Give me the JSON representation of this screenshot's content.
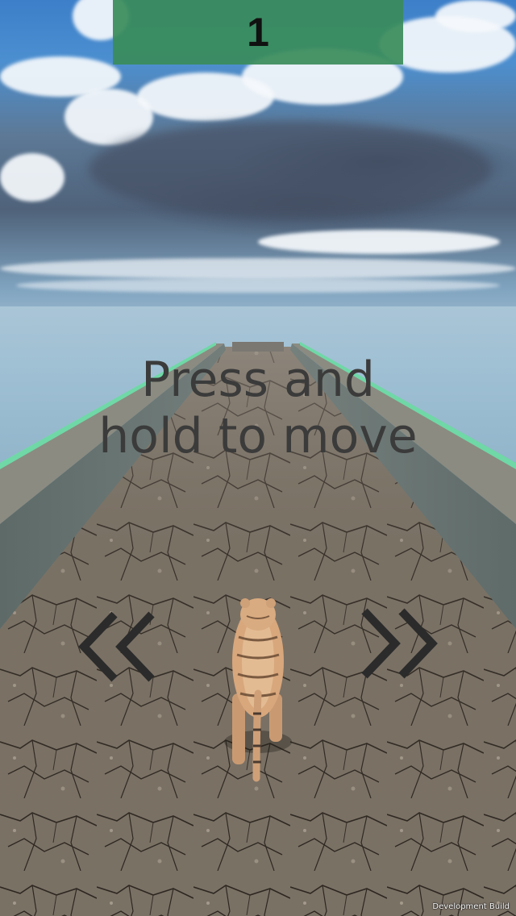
{
  "hud": {
    "score": "1",
    "score_panel_color": "#3a8c5a"
  },
  "instruction": {
    "line1": "Press and",
    "line2": "hold to move"
  },
  "controls": {
    "left_icon": "double-chevron-left-icon",
    "right_icon": "double-chevron-right-icon",
    "arrow_color": "#2b2b2b"
  },
  "footer": {
    "build_label": "Development Build"
  },
  "scene": {
    "road_color": "#7f766a",
    "wall_color": "#8a8a80",
    "wall_edge_color": "#6fd8a6",
    "sky_color": "#4c8fd0",
    "character": "tiger"
  }
}
